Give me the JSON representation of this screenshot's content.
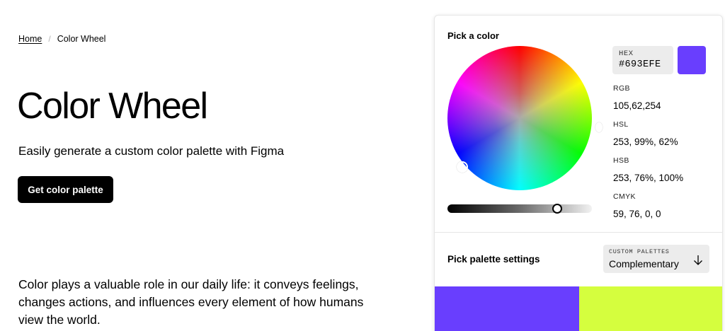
{
  "breadcrumb": {
    "home": "Home",
    "separator": "/",
    "current": "Color Wheel"
  },
  "hero": {
    "title": "Color Wheel",
    "subtitle": "Easily generate a custom color palette with Figma",
    "cta_label": "Get color palette"
  },
  "intro": {
    "text": "Color plays a valuable role in our daily life: it conveys feelings, changes actions, and influences every element of how humans view the world."
  },
  "picker": {
    "title": "Pick a color",
    "hex_label": "HEX",
    "hex_value": "#693EFE",
    "swatch_color": "#693EFE",
    "brightness_level": 0.76,
    "values": {
      "rgb_label": "RGB",
      "rgb_value": "105,62,254",
      "hsl_label": "HSL",
      "hsl_value": "253, 99%, 62%",
      "hsb_label": "HSB",
      "hsb_value": "253, 76%, 100%",
      "cmyk_label": "CMYK",
      "cmyk_value": "59, 76, 0, 0"
    }
  },
  "palette": {
    "title": "Pick palette settings",
    "select_label": "CUSTOM PALETTES",
    "select_value": "Complementary",
    "arrow_icon": "arrow-down-icon",
    "colors": [
      "#693EFE",
      "#D5FE3E"
    ]
  }
}
